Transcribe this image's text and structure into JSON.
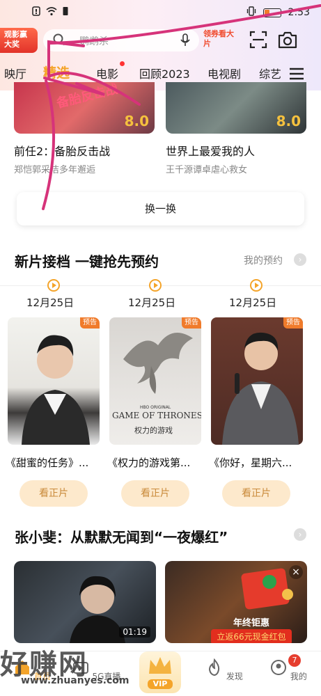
{
  "status_bar": {
    "time": "2:53",
    "left_icons": [
      "notification-icon",
      "wifi-icon",
      "sim-icon"
    ],
    "right_icons": [
      "vibrate-icon",
      "battery-icon"
    ],
    "battery_level": 0.3
  },
  "header": {
    "promo_badge": "观影赢大奖",
    "search_placeholder": "鹦鹉杀",
    "vip_promo": "领券看大片"
  },
  "tabs": [
    {
      "label": "映厅",
      "active": false
    },
    {
      "label": "精选",
      "active": true
    },
    {
      "label": "电影",
      "active": false
    },
    {
      "label": "回顾2023",
      "active": false
    },
    {
      "label": "电视剧",
      "active": false
    },
    {
      "label": "综艺",
      "active": false
    }
  ],
  "featured": [
    {
      "title": "前任2：备胎反击战",
      "subtitle": "郑恺郭采洁多年邂逅",
      "poster_text": "备胎反击战",
      "score": "8.0"
    },
    {
      "title": "世界上最爱我的人",
      "subtitle": "王千源谭卓虐心救女",
      "score": "8.0"
    }
  ],
  "refresh_label": "换一换",
  "new_releases": {
    "title": "新片接档 一键抢先预约",
    "my_reservations": "我的预约",
    "items": [
      {
        "date": "12月25日",
        "badge": "预告",
        "name": "《甜蜜的任务》...",
        "button": "看正片"
      },
      {
        "date": "12月25日",
        "badge": "预告",
        "name": "《权力的游戏第...",
        "button": "看正片",
        "poster_caption": "GAME OF THRONES",
        "poster_sub": "权力的游戏",
        "poster_brand": "HBO ORIGINAL"
      },
      {
        "date": "12月25日",
        "badge": "预告",
        "name": "《你好，星期六...",
        "button": "看正片"
      }
    ]
  },
  "story_section": {
    "title": "张小斐：从默默无闻到“一夜爆红”",
    "video_duration": "01:19",
    "ad_title": "年终钜惠",
    "ad_promo": "立返66元现金红包"
  },
  "bottom_nav": [
    {
      "label": "首页",
      "active": true
    },
    {
      "label": "5G直播",
      "active": false
    },
    {
      "label": "VIP",
      "active": false
    },
    {
      "label": "发现",
      "active": false
    },
    {
      "label": "我的",
      "active": false,
      "badge": "7"
    }
  ],
  "watermark": {
    "text": "好赚网",
    "url": "www.zhuanyes.com"
  },
  "colors": {
    "accent": "#f4a42a",
    "promo_red": "#e2332a",
    "scribble": "#d6337a"
  }
}
